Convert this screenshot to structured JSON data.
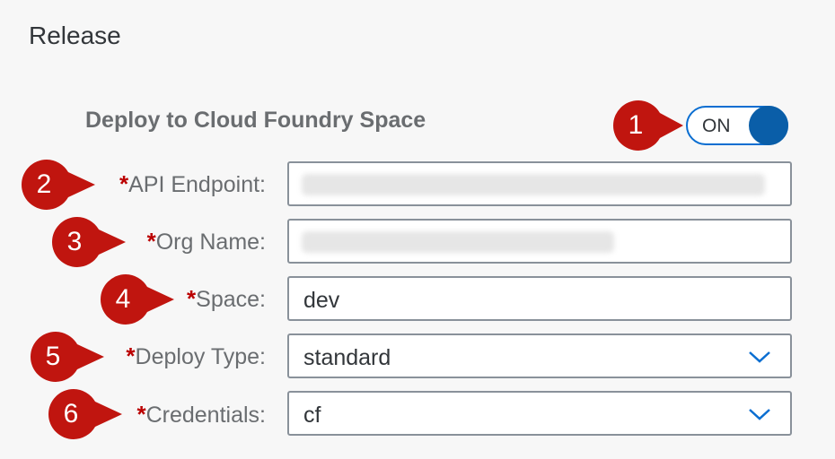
{
  "release": {
    "title": "Release"
  },
  "deploy_section": {
    "label": "Deploy to Cloud Foundry Space",
    "toggle_state": "ON"
  },
  "callouts": [
    "1",
    "2",
    "3",
    "4",
    "5",
    "6"
  ],
  "form": {
    "required_marker": "*",
    "api_endpoint": {
      "label": "API Endpoint:",
      "value_blurred": true
    },
    "org_name": {
      "label": "Org Name:",
      "value_blurred": true
    },
    "space": {
      "label": "Space:",
      "value": "dev"
    },
    "deploy_type": {
      "label": "Deploy Type:",
      "value": "standard"
    },
    "credentials": {
      "label": "Credentials:",
      "value": "cf"
    }
  },
  "colors": {
    "accent": "#0a6ed1",
    "required": "#bb0000",
    "callout": "#c0150f"
  },
  "icons": {
    "dropdown": "chevron-down-icon"
  }
}
